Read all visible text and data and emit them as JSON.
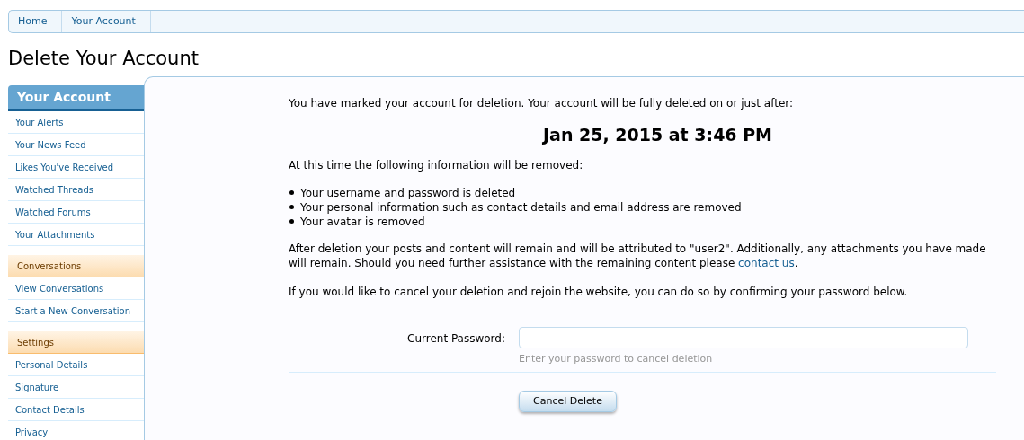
{
  "breadcrumb": [
    {
      "label": "Home"
    },
    {
      "label": "Your Account"
    }
  ],
  "page_title": "Delete Your Account",
  "sidebar": {
    "sections": [
      {
        "title": "Your Account",
        "kind": "primary",
        "items": [
          "Your Alerts",
          "Your News Feed",
          "Likes You've Received",
          "Watched Threads",
          "Watched Forums",
          "Your Attachments"
        ]
      },
      {
        "title": "Conversations",
        "kind": "secondary",
        "items": [
          "View Conversations",
          "Start a New Conversation"
        ]
      },
      {
        "title": "Settings",
        "kind": "secondary",
        "items": [
          "Personal Details",
          "Signature",
          "Contact Details",
          "Privacy"
        ]
      }
    ]
  },
  "content": {
    "intro": "You have marked your account for deletion. Your account will be fully deleted on or just after:",
    "deletion_date": "Jan 25, 2015 at 3:46 PM",
    "removal_heading": "At this time the following information will be removed:",
    "removed_items": [
      "Your username and password is deleted",
      "Your personal information such as contact details and email address are removed",
      "Your avatar is removed"
    ],
    "retention_text": "After deletion your posts and content will remain and will be attributed to \"user2\". Additionally, any attachments you have made will remain. Should you need further assistance with the remaining content please",
    "contact_link": "contact us",
    "retention_end": ".",
    "cancel_text": "If you would like to cancel your deletion and rejoin the website, you can do so by confirming your password below.",
    "password_field": {
      "label": "Current Password:",
      "hint": "Enter your password to cancel deletion"
    },
    "submit_button": "Cancel Delete"
  }
}
